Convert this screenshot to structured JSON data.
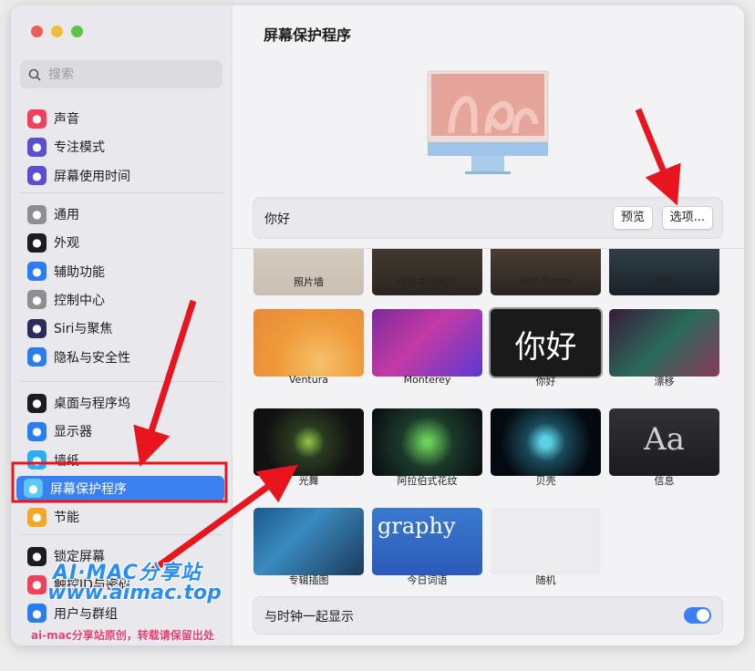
{
  "sidebar": {
    "search_placeholder": "搜索",
    "groups": [
      [
        {
          "label": "声音",
          "icon": "speaker-icon",
          "color": "#f0405a"
        },
        {
          "label": "专注模式",
          "icon": "moon-icon",
          "color": "#5a4fcf"
        },
        {
          "label": "屏幕使用时间",
          "icon": "hourglass-icon",
          "color": "#5a4fcf"
        }
      ],
      [
        {
          "label": "通用",
          "icon": "gear-icon",
          "color": "#8e8e93"
        },
        {
          "label": "外观",
          "icon": "appearance-icon",
          "color": "#1c1c1e"
        },
        {
          "label": "辅助功能",
          "icon": "accessibility-icon",
          "color": "#2a7df0"
        },
        {
          "label": "控制中心",
          "icon": "control-center-icon",
          "color": "#8e8e93"
        },
        {
          "label": "Siri与聚焦",
          "icon": "siri-icon",
          "color": "#2b2b60"
        },
        {
          "label": "隐私与安全性",
          "icon": "hand-icon",
          "color": "#2a7df0"
        }
      ],
      [
        {
          "label": "桌面与程序坞",
          "icon": "dock-icon",
          "color": "#1c1c1e"
        },
        {
          "label": "显示器",
          "icon": "sun-icon",
          "color": "#2a7df0"
        },
        {
          "label": "墙纸",
          "icon": "wallpaper-icon",
          "color": "#2ab0f0"
        },
        {
          "label": "屏幕保护程序",
          "icon": "screensaver-icon",
          "color": "#5ac8fa",
          "active": true
        },
        {
          "label": "节能",
          "icon": "bulb-icon",
          "color": "#f5a623"
        }
      ],
      [
        {
          "label": "锁定屏幕",
          "icon": "lock-icon",
          "color": "#1c1c1e"
        },
        {
          "label": "触控ID与密码",
          "icon": "fingerprint-icon",
          "color": "#f0405a"
        },
        {
          "label": "用户与群组",
          "icon": "users-icon",
          "color": "#2a7df0"
        }
      ]
    ]
  },
  "main": {
    "title": "屏幕保护程序",
    "selected_name": "你好",
    "preview_button": "预览",
    "options_button": "选项...",
    "savers": [
      {
        "label": "照片墙",
        "style": "photo-wall"
      },
      {
        "label": "怀旧冲印照片",
        "style": "vintage"
      },
      {
        "label": "Ken Burns",
        "style": "kenburns"
      },
      {
        "label": "经典",
        "style": "classic"
      },
      {
        "label": "Ventura",
        "style": "ventura"
      },
      {
        "label": "Monterey",
        "style": "monterey"
      },
      {
        "label": "你好",
        "style": "hello",
        "thumb_text": "你好",
        "selected": true
      },
      {
        "label": "漂移",
        "style": "drift"
      },
      {
        "label": "光舞",
        "style": "flurry"
      },
      {
        "label": "阿拉伯式花纹",
        "style": "arabesque"
      },
      {
        "label": "贝壳",
        "style": "shell"
      },
      {
        "label": "信息",
        "style": "message",
        "thumb_text": "Aa"
      },
      {
        "label": "专辑插图",
        "style": "album"
      },
      {
        "label": "今日词语",
        "style": "word",
        "thumb_text": "graphy"
      },
      {
        "label": "随机",
        "style": "random"
      }
    ],
    "clock_toggle_label": "与时钟一起显示",
    "clock_toggle_on": true
  },
  "watermark": {
    "line1": "AI·MAC分享站",
    "line2": "www.aimac.top",
    "line3": "ai-mac分享站原创，转载请保留出处"
  }
}
